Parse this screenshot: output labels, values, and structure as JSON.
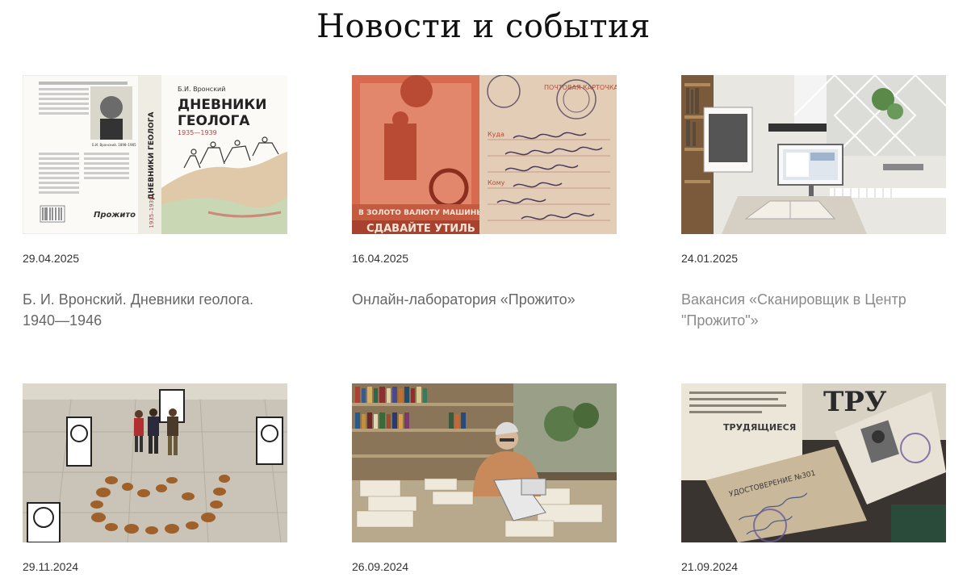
{
  "header": {
    "title": "Новости и события"
  },
  "news": [
    {
      "date": "29.04.2025",
      "title": "Б. И. Вронский. Дневники геолога. 1940—1946",
      "image": "book-cover-image",
      "book": {
        "author": "Б.И. Вронский",
        "title_line1": "ДНЕВНИКИ",
        "title_line2": "ГЕОЛОГА",
        "years": "1935—1939",
        "spine": "ДНЕВНИКИ ГЕОЛОГА",
        "spine_years": "1935–1939",
        "publisher": "Прожито",
        "caption": "Б.И. Вронский. 1898–1985"
      }
    },
    {
      "date": "16.04.2025",
      "title": "Онлайн-лаборатория «Прожито»",
      "image": "postcard-image",
      "postcard": {
        "banner1": "В ЗОЛОТО ВАЛЮТУ МАШИНЫ",
        "banner2": "СДАВАЙТЕ УТИЛЬ",
        "header": "ПОЧТОВАЯ КАРТОЧКА",
        "line1": "Куда",
        "line2": "Кому"
      }
    },
    {
      "date": "24.01.2025",
      "title": "Вакансия «Сканировщик в Центр \"Прожито\"»",
      "image": "scanner-room-image"
    },
    {
      "date": "29.11.2024",
      "title": "",
      "image": "exhibition-hall-image"
    },
    {
      "date": "26.09.2024",
      "title": "",
      "image": "library-desk-image"
    },
    {
      "date": "21.09.2024",
      "title": "",
      "image": "party-card-image",
      "docs": {
        "newspaper": "ТРУ",
        "card_header": "УДОСТОВЕРЕНИЕ №301",
        "banner": "ТРУДЯЩИЕСЯ"
      }
    }
  ],
  "colors": {
    "background": "#ffffff",
    "date": "#333333",
    "title": "#666666"
  }
}
